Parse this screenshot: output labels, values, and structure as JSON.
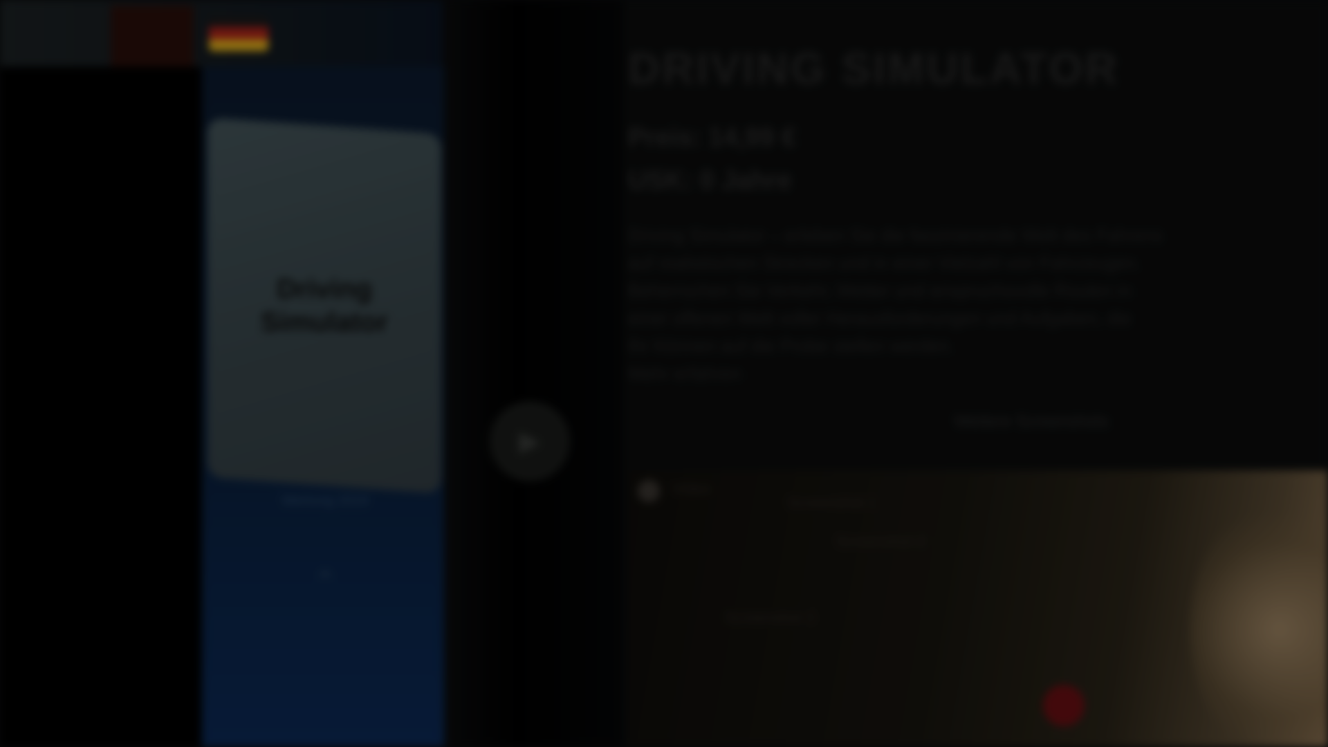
{
  "header": {
    "logo_icon": "brand-logo-icon",
    "language_icon": "flag-de-icon",
    "flag_colors": [
      "#1a1a1a",
      "#b0241c",
      "#e8b41c"
    ]
  },
  "card": {
    "title": "Driving Simulator",
    "caption": "Wertung 2019",
    "arrow_icon": "chevron-up-icon"
  },
  "middle": {
    "play_button_icon": "play-circle-icon"
  },
  "main": {
    "title": "DRIVING SIMULATOR",
    "line1": "Preis: 14,99 €",
    "line2": "USK: 0 Jahre",
    "description": [
      "Driving Simulator – erleben Sie die faszinierende Welt des Fahrens",
      "auf realistischen Strecken und in einer Vielzahl von Fahrzeugen.",
      "Beherrschen Sie Verkehr, Wetter und anspruchsvolle Routen in",
      "einer offenen Welt voller Herausforderungen und Aufgaben, die",
      "Ihr Können auf die Probe stellen werden.",
      "Mehr erfahren"
    ],
    "more_link": "Weitere Screenshots"
  },
  "preview": {
    "items": [
      "Video",
      "Screenshot 1",
      "Screenshot 2",
      "Screenshot 3"
    ],
    "record_icon": "record-icon"
  }
}
